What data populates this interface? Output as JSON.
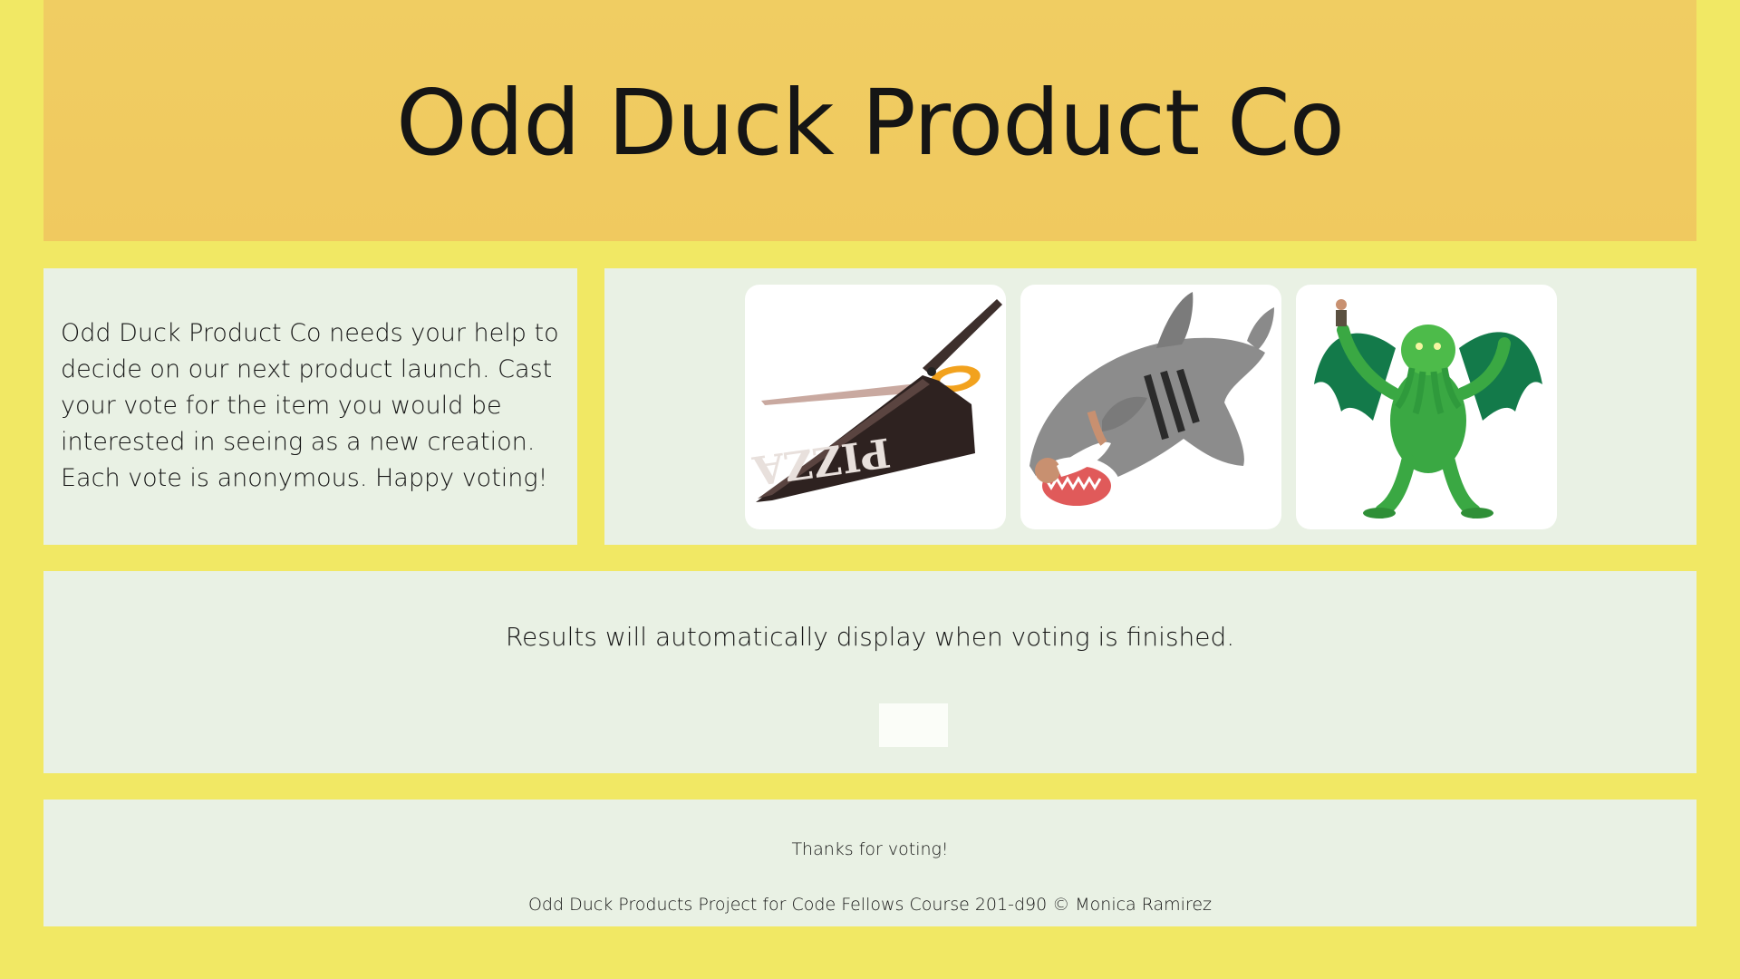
{
  "header": {
    "title": "Odd Duck Product Co"
  },
  "intro": {
    "text": "Odd Duck Product Co needs your help to decide on our next product launch. Cast your vote for the item you would be interested in seeing as a new creation. Each vote is anonymous. Happy voting!"
  },
  "products": [
    {
      "name": "pizza-scissors",
      "icon": "pizza-scissors-image"
    },
    {
      "name": "shark-sleeping-bag",
      "icon": "shark-image"
    },
    {
      "name": "cthulhu-figure",
      "icon": "cthulhu-image"
    }
  ],
  "results": {
    "message": "Results will automatically display when voting is finished.",
    "button_label": ""
  },
  "footer": {
    "thanks": "Thanks for voting!",
    "credit": "Odd Duck Products Project for Code Fellows Course 201-d90 © Monica Ramirez"
  },
  "colors": {
    "page_background": "#f1e864",
    "header_background": "#f0cd62",
    "panel_background": "#e9f1e4",
    "card_background": "#ffffff"
  }
}
